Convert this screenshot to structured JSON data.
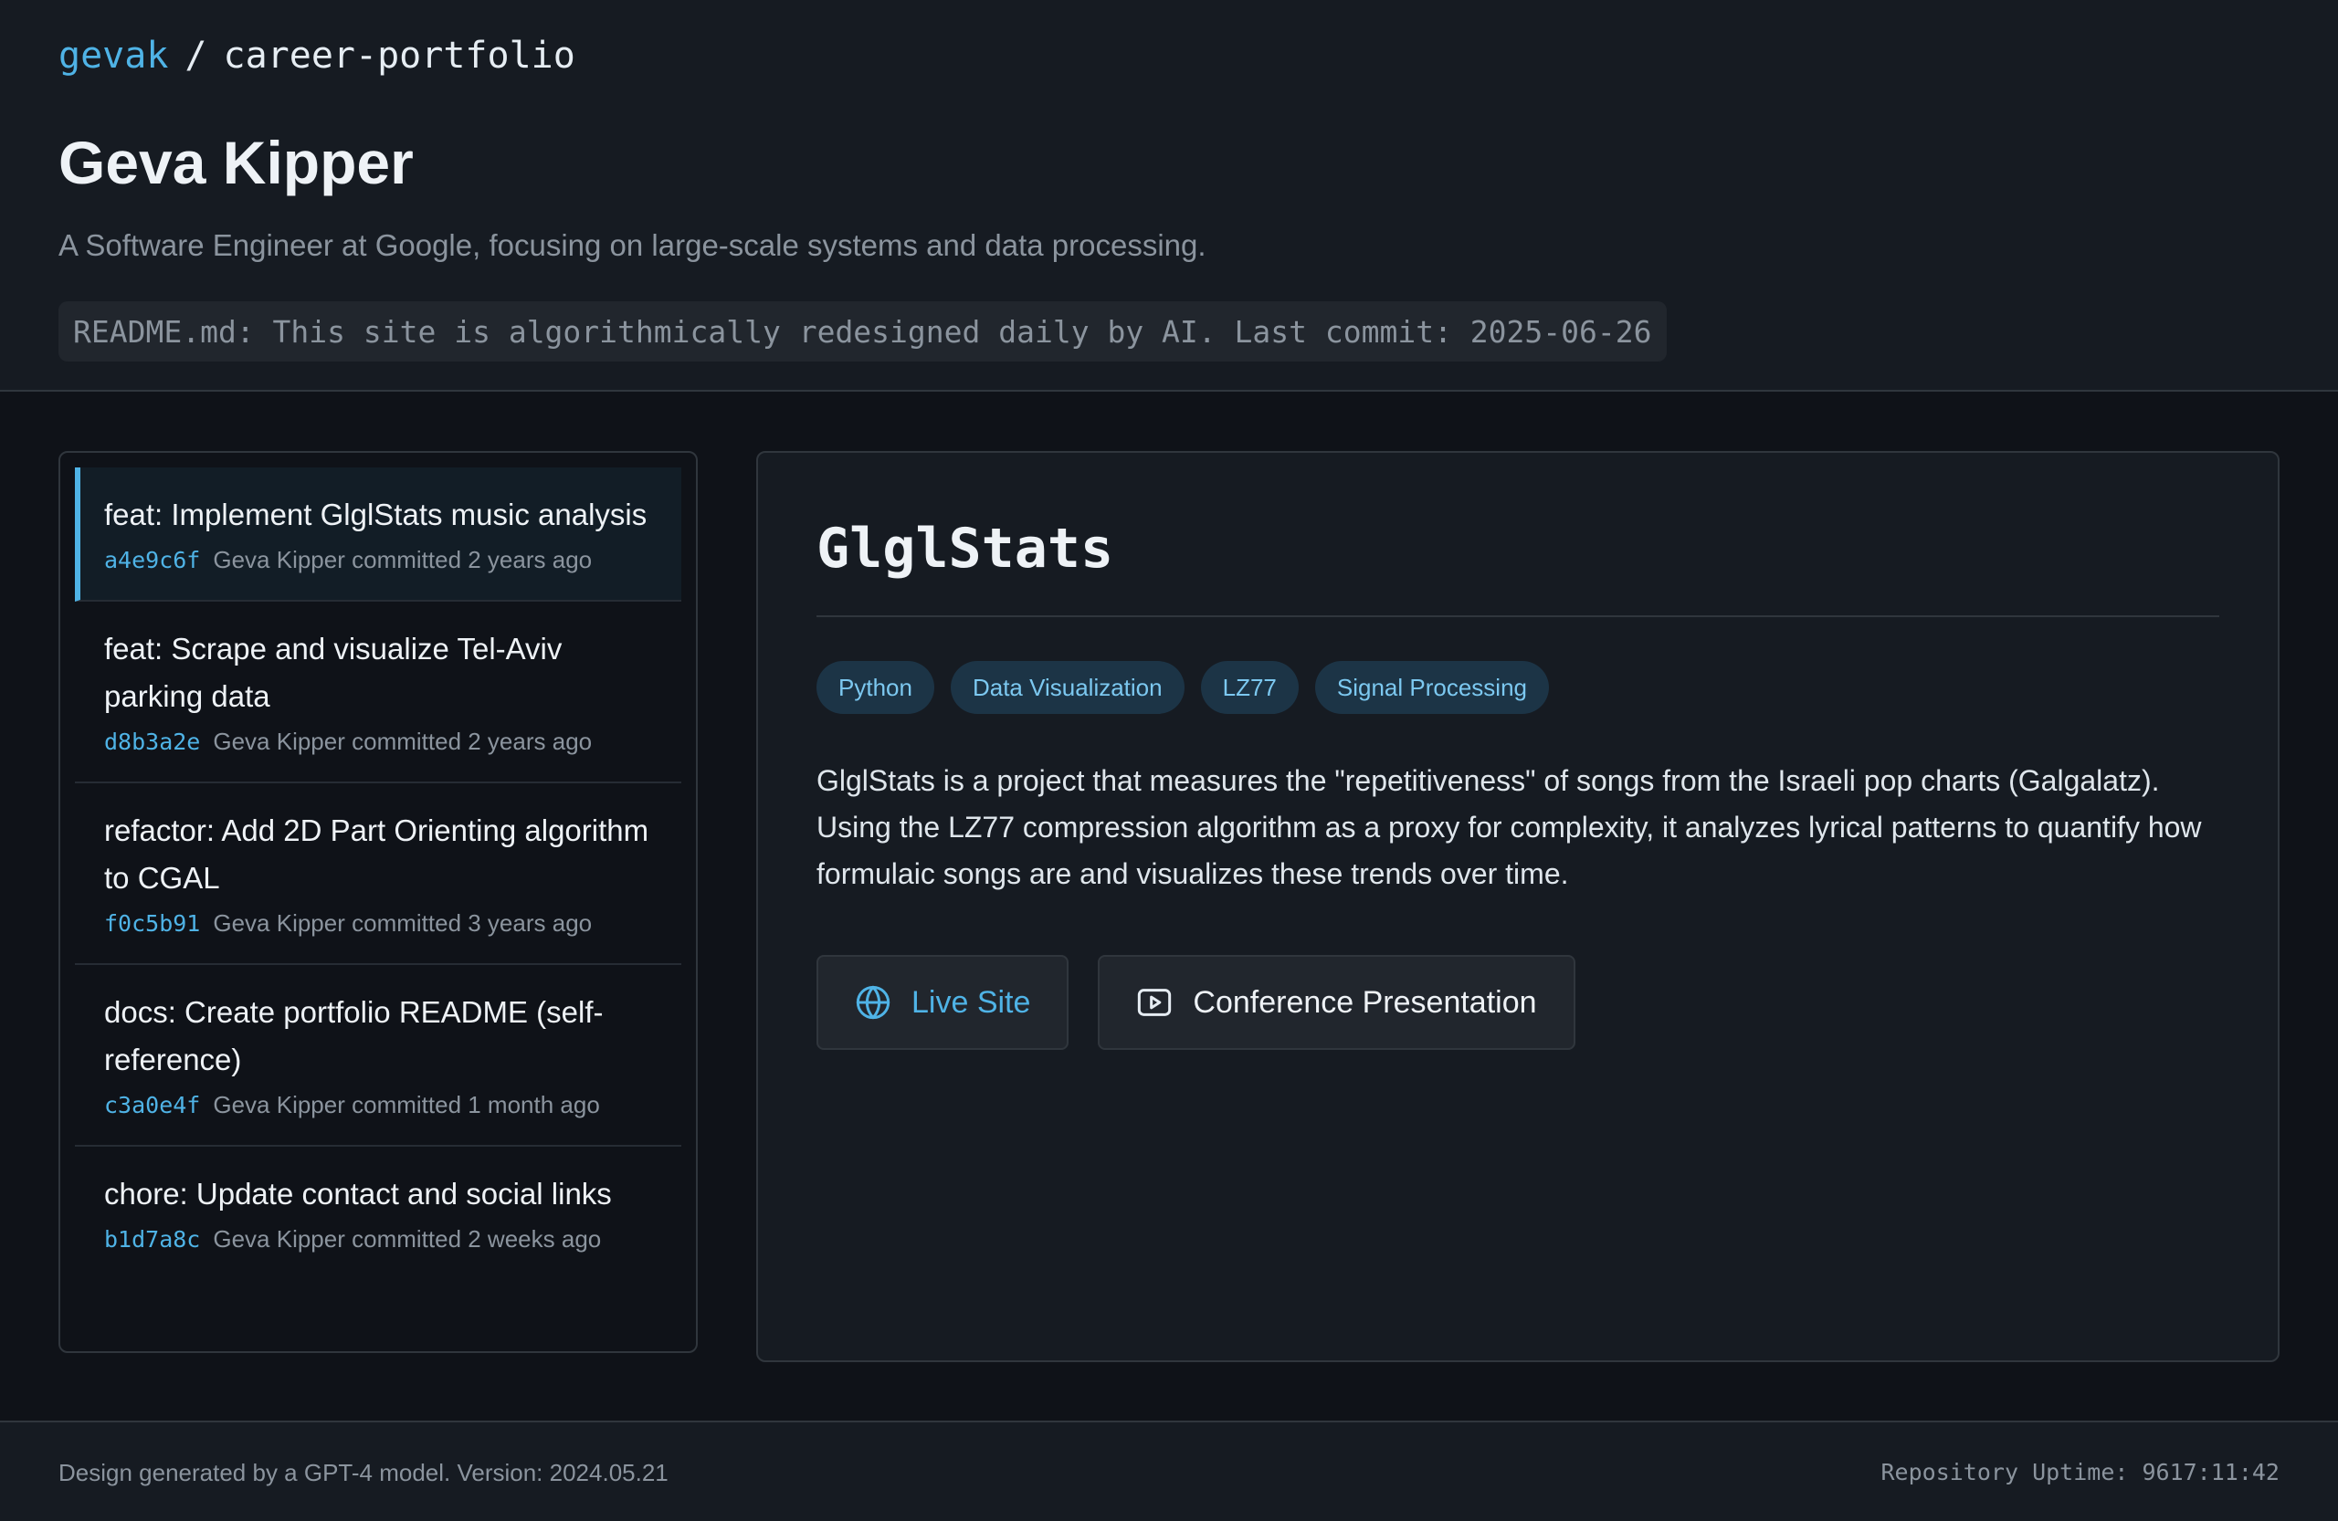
{
  "header": {
    "owner": "gevak",
    "separator": "/",
    "repo": "career-portfolio",
    "title": "Geva Kipper",
    "subtitle": "A Software Engineer at Google, focusing on large-scale systems and data processing.",
    "readme_banner": "README.md: This site is algorithmically redesigned daily by AI. Last commit: 2025-06-26"
  },
  "commits": [
    {
      "message": "feat: Implement GlglStats music analysis",
      "hash": "a4e9c6f",
      "meta": "Geva Kipper committed 2 years ago",
      "active": true
    },
    {
      "message": "feat: Scrape and visualize Tel-Aviv parking data",
      "hash": "d8b3a2e",
      "meta": "Geva Kipper committed 2 years ago",
      "active": false
    },
    {
      "message": "refactor: Add 2D Part Orienting algorithm to CGAL",
      "hash": "f0c5b91",
      "meta": "Geva Kipper committed 3 years ago",
      "active": false
    },
    {
      "message": "docs: Create portfolio README (self-reference)",
      "hash": "c3a0e4f",
      "meta": "Geva Kipper committed 1 month ago",
      "active": false
    },
    {
      "message": "chore: Update contact and social links",
      "hash": "b1d7a8c",
      "meta": "Geva Kipper committed 2 weeks ago",
      "active": false
    }
  ],
  "detail": {
    "title": "GlglStats",
    "tags": [
      "Python",
      "Data Visualization",
      "LZ77",
      "Signal Processing"
    ],
    "description": "GlglStats is a project that measures the \"repetitiveness\" of songs from the Israeli pop charts (Galgalatz). Using the LZ77 compression algorithm as a proxy for complexity, it analyzes lyrical patterns to quantify how formulaic songs are and visualizes these trends over time.",
    "links": {
      "live_site": {
        "label": "Live Site",
        "icon": "globe-icon"
      },
      "presentation": {
        "label": "Conference Presentation",
        "icon": "video-play-icon"
      }
    }
  },
  "footer": {
    "left": "Design generated by a GPT-4 model. Version: 2024.05.21",
    "right": "Repository Uptime: 9617:11:42"
  },
  "colors": {
    "accent": "#4fb3e6",
    "background": "#0f1218",
    "panel": "#161b22",
    "tag_bg": "#1c3446"
  }
}
